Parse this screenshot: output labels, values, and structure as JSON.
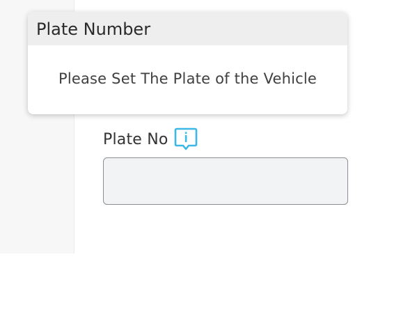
{
  "field": {
    "label": "Plate No",
    "value": "",
    "placeholder": "",
    "info_icon": "info-chat-bubble-icon"
  },
  "tooltip": {
    "title": "Plate Number",
    "message": "Please Set The Plate of the Vehicle"
  },
  "colors": {
    "accent_icon": "#3bb8e8",
    "tooltip_header_bg": "#eeeeee",
    "input_bg": "#f1f3f5",
    "input_border": "#8a8f95",
    "side_panel_bg": "#f7f7f7"
  }
}
